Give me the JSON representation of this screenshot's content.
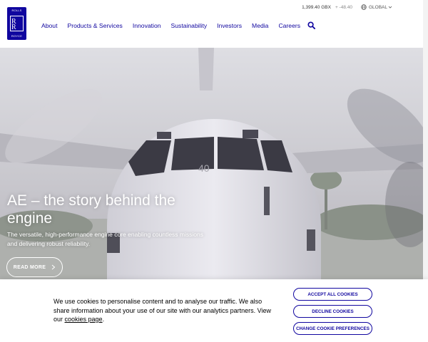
{
  "brand": {
    "logo_top": "ROLLS",
    "logo_bottom": "ROYCE",
    "logo_color": "#10069f"
  },
  "utility": {
    "share_price": "1,399.40 GBX",
    "change": "+ -48.40",
    "region": "GLOBAL",
    "icons": [
      "globe-icon",
      "chevron-down-icon"
    ]
  },
  "nav": {
    "items": [
      "About",
      "Products & Services",
      "Innovation",
      "Sustainability",
      "Investors",
      "Media",
      "Careers"
    ],
    "search_icon": "search-icon"
  },
  "hero": {
    "title": "AE – the story behind the engine",
    "text": "The versatile, high-performance engine core enabling countless missions and delivering robust reliability.",
    "cta": "READ MORE",
    "aircraft_number": "40"
  },
  "cookie": {
    "text_before": "We use cookies to personalise content and to analyse our traffic. We also share information about your use of our site with our analytics partners. View our ",
    "link": "cookies page",
    "text_after": ".",
    "accept": "ACCEPT ALL COOKIES",
    "decline": "DECLINE COOKIES",
    "preferences": "CHANGE COOKIE PREFERENCES"
  },
  "colors": {
    "brand": "#10069f",
    "background": "#ffffff"
  }
}
